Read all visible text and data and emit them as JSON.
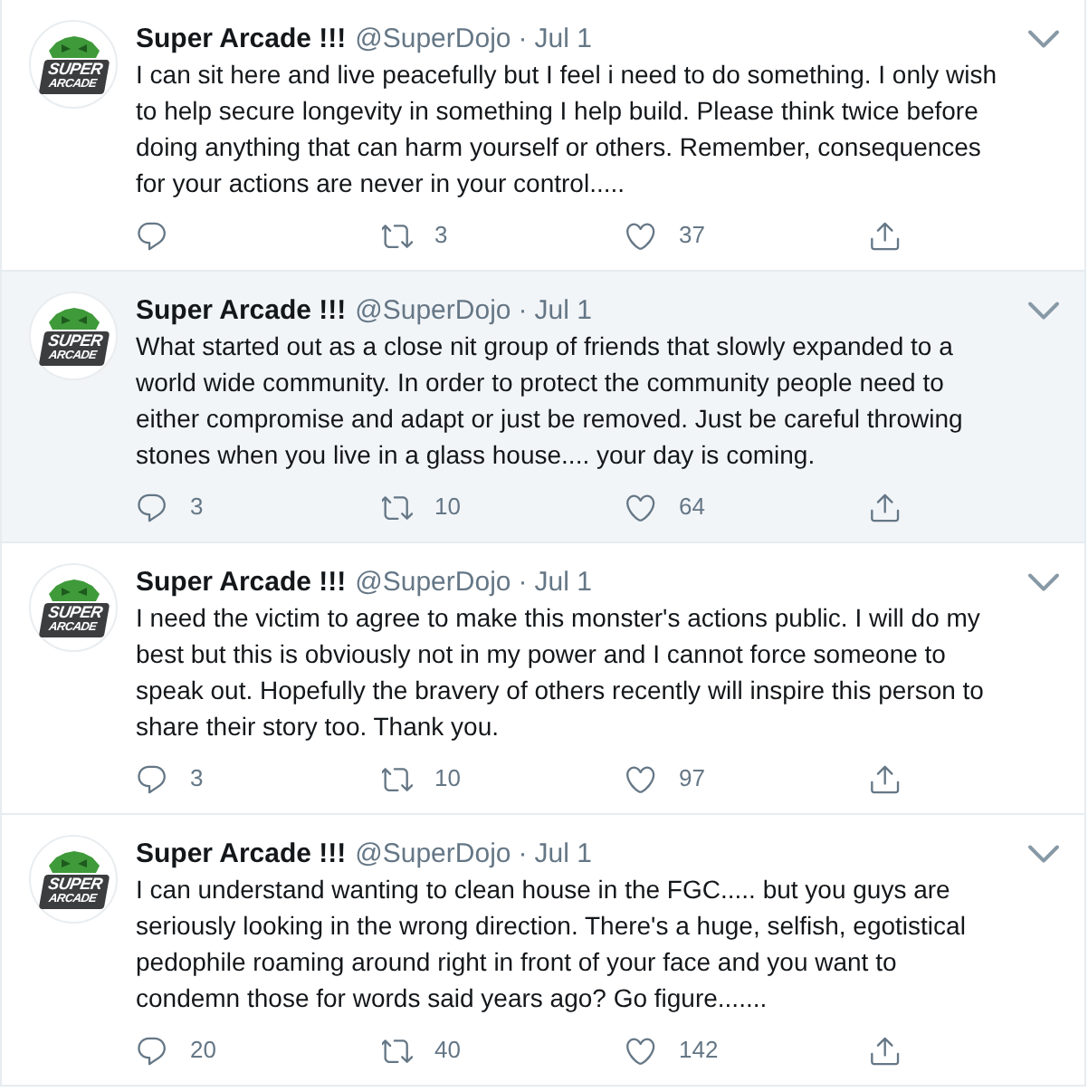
{
  "tweets": [
    {
      "hovered": false,
      "avatar": {
        "logo_lines": [
          "SUPER",
          "ARCADE"
        ]
      },
      "author": "Super Arcade !!!",
      "handle": "@SuperDojo",
      "separator": "·",
      "date": "Jul 1",
      "text_lines": [
        "I can sit here and live peacefully but I feel i need to do something. I only wish",
        "to help secure longevity in something I help build. Please think twice before",
        "doing anything that can harm yourself or others. Remember, consequences",
        "for your actions are never in your control....."
      ],
      "actions": [
        {
          "kind": "reply"
        },
        {
          "kind": "retweet",
          "count": "3"
        },
        {
          "kind": "like",
          "count": "37"
        },
        {
          "kind": "share"
        }
      ]
    },
    {
      "hovered": true,
      "avatar": {
        "logo_lines": [
          "SUPER",
          "ARCADE"
        ]
      },
      "author": "Super Arcade !!!",
      "handle": "@SuperDojo",
      "separator": "·",
      "date": "Jul 1",
      "text_lines": [
        "What started out as a close nit group of friends that slowly expanded to a",
        "world wide community. In order to protect the community people need to",
        "either compromise and adapt or just be removed. Just be careful throwing",
        "stones when you live in a glass house.... your day is coming."
      ],
      "actions": [
        {
          "kind": "reply",
          "count": "3"
        },
        {
          "kind": "retweet",
          "count": "10"
        },
        {
          "kind": "like",
          "count": "64"
        },
        {
          "kind": "share"
        }
      ]
    },
    {
      "hovered": false,
      "avatar": {
        "logo_lines": [
          "SUPER",
          "ARCADE"
        ]
      },
      "author": "Super Arcade !!!",
      "handle": "@SuperDojo",
      "separator": "·",
      "date": "Jul 1",
      "text_lines": [
        "I need the victim to agree to make this monster's actions public. I will do my",
        "best but this is obviously not in my power and I cannot force someone to",
        "speak out. Hopefully the bravery of others recently will inspire this person to",
        "share their story too. Thank you."
      ],
      "actions": [
        {
          "kind": "reply",
          "count": "3"
        },
        {
          "kind": "retweet",
          "count": "10"
        },
        {
          "kind": "like",
          "count": "97"
        },
        {
          "kind": "share"
        }
      ]
    },
    {
      "hovered": false,
      "avatar": {
        "logo_lines": [
          "SUPER",
          "ARCADE"
        ]
      },
      "author": "Super Arcade !!!",
      "handle": "@SuperDojo",
      "separator": "·",
      "date": "Jul 1",
      "text_lines": [
        "I can understand wanting to clean house in the FGC..... but you guys are",
        "seriously looking in the wrong direction. There's a huge, selfish, egotistical",
        "pedophile roaming around right in front of your face and you want to",
        "condemn those for words said years ago? Go figure......."
      ],
      "actions": [
        {
          "kind": "reply",
          "count": "20"
        },
        {
          "kind": "retweet",
          "count": "40"
        },
        {
          "kind": "like",
          "count": "142"
        },
        {
          "kind": "share"
        }
      ]
    }
  ]
}
